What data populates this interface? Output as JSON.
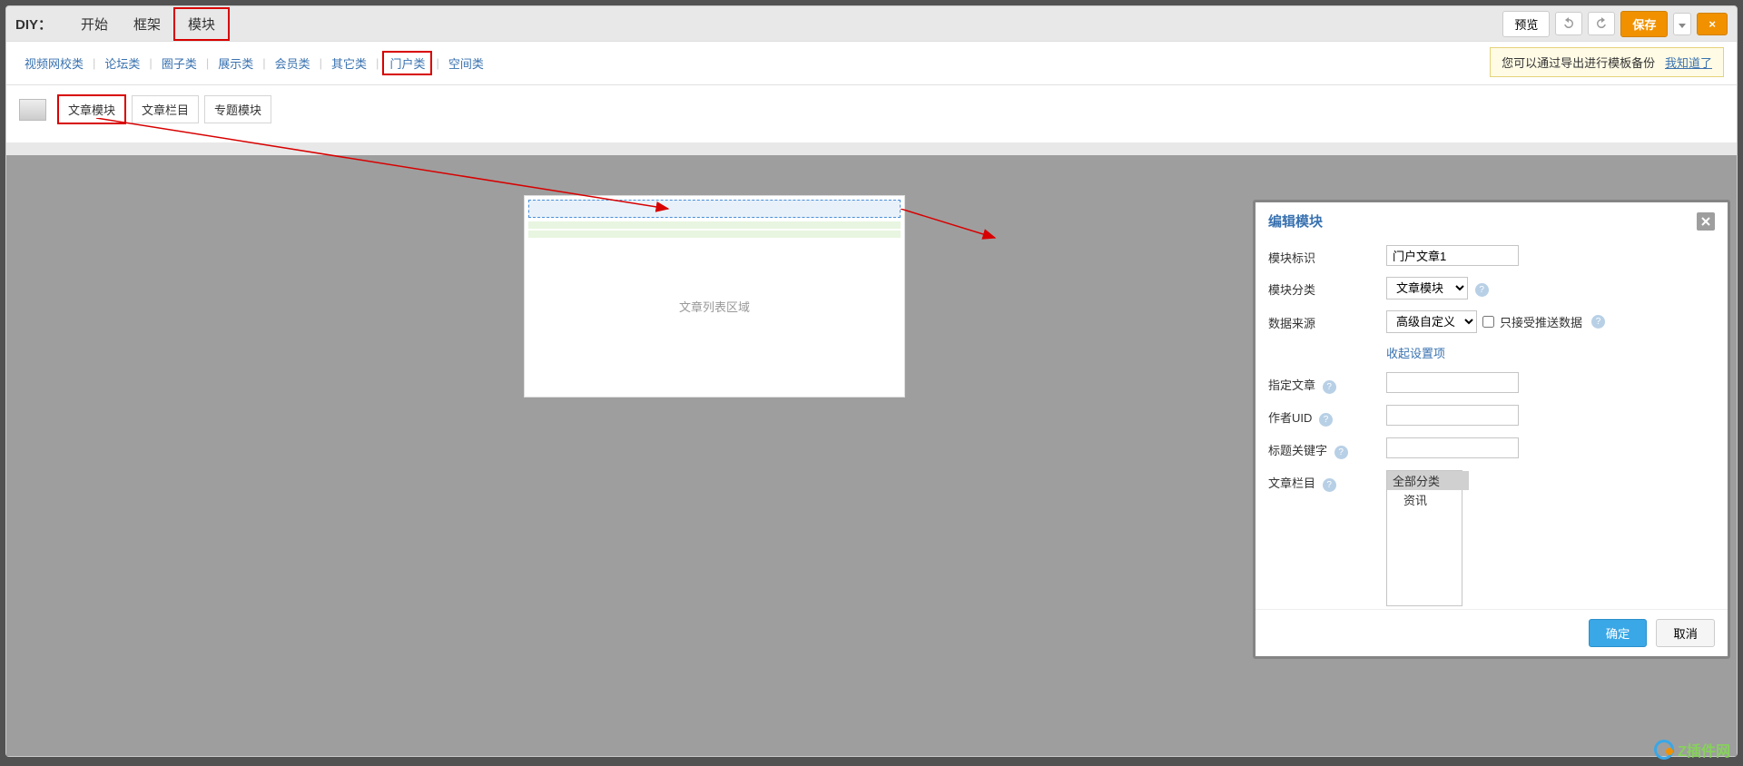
{
  "header": {
    "diy_label": "DIY：",
    "tabs": [
      "开始",
      "框架",
      "模块"
    ],
    "active_tab_index": 2
  },
  "toolbar_right": {
    "preview": "预览",
    "save": "保存",
    "close": "×"
  },
  "categories": {
    "items": [
      "视频网校类",
      "论坛类",
      "圈子类",
      "展示类",
      "会员类",
      "其它类",
      "门户类",
      "空间类"
    ],
    "highlighted_index": 6
  },
  "backup_tip": {
    "text": "您可以通过导出进行模板备份",
    "link": "我知道了"
  },
  "submodules": {
    "items": [
      "文章模块",
      "文章栏目",
      "专题模块"
    ],
    "highlighted_index": 0
  },
  "drop_region": {
    "body_text": "文章列表区域"
  },
  "dialog": {
    "title": "编辑模块",
    "fields": {
      "module_id": {
        "label": "模块标识",
        "value": "门户文章1"
      },
      "module_cat": {
        "label": "模块分类",
        "value": "文章模块"
      },
      "data_source": {
        "label": "数据来源",
        "value": "高级自定义",
        "checkbox_label": "只接受推送数据"
      },
      "collapse_link": "收起设置项",
      "specify_article": {
        "label": "指定文章",
        "value": ""
      },
      "author_uid": {
        "label": "作者UID",
        "value": ""
      },
      "title_keyword": {
        "label": "标题关键字",
        "value": ""
      },
      "article_column": {
        "label": "文章栏目",
        "options": [
          "全部分类",
          "资讯"
        ],
        "selected_index": 0
      }
    },
    "ok": "确定",
    "cancel": "取消"
  },
  "watermark": "Z插件网"
}
